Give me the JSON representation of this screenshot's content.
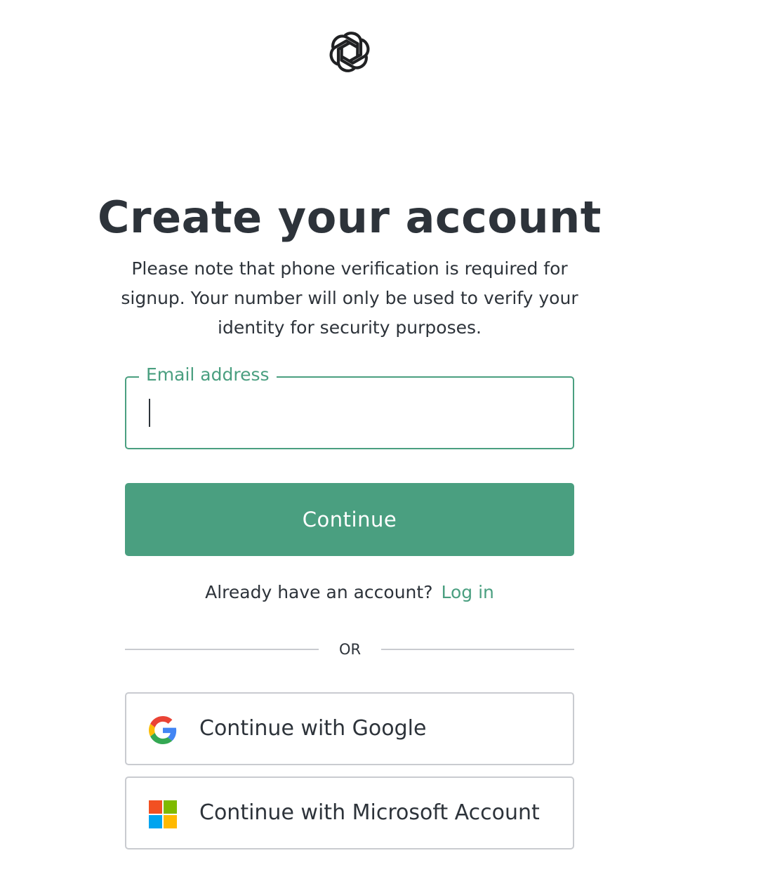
{
  "logo": {
    "icon": "openai-logo-icon"
  },
  "heading": "Create your account",
  "subtitle": "Please note that phone verification is required for signup. Your number will only be used to verify your identity for security purposes.",
  "email": {
    "label": "Email address",
    "value": "",
    "placeholder": ""
  },
  "continue_label": "Continue",
  "login": {
    "prompt": "Already have an account?",
    "link_label": "Log in"
  },
  "divider_label": "OR",
  "social": {
    "google_label": "Continue with Google",
    "google_icon": "google-icon",
    "microsoft_label": "Continue with Microsoft Account",
    "microsoft_icon": "microsoft-icon"
  },
  "colors": {
    "accent": "#4a9f80",
    "text": "#2d333a",
    "border": "#c9cbd0"
  }
}
